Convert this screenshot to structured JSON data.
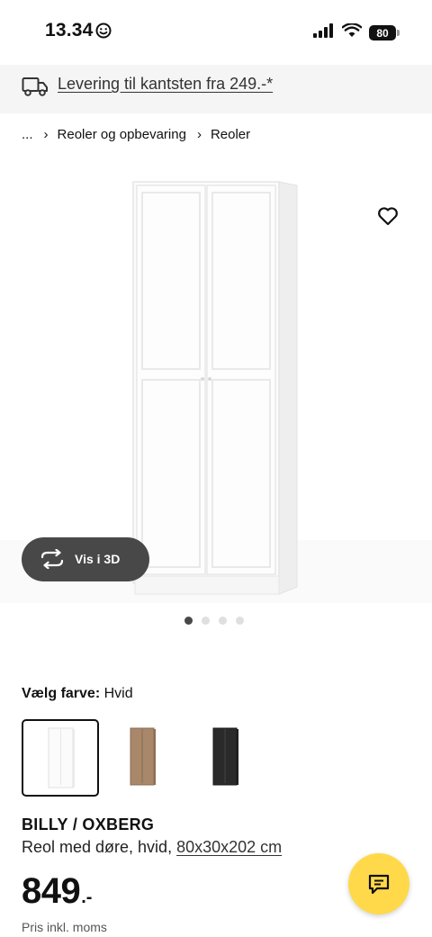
{
  "status_bar": {
    "time": "13.34",
    "emoji_icon": "smiley-face-icon",
    "battery": "80"
  },
  "delivery_banner": {
    "icon": "truck-icon",
    "text": "Levering til kantsten fra 249.-*"
  },
  "breadcrumb": {
    "items": [
      "...",
      "Reoler og opbevaring",
      "Reoler"
    ]
  },
  "product_image": {
    "favorite_icon": "heart-icon",
    "view_3d_label": "Vis i 3D",
    "carousel_count": 4,
    "carousel_active_index": 0
  },
  "color_picker": {
    "label": "Vælg farve:",
    "selected": "Hvid",
    "swatches": [
      "white",
      "oak-effect",
      "black"
    ]
  },
  "product": {
    "name": "BILLY / OXBERG",
    "description": "Reol med døre, hvid,",
    "size": "80x30x202 cm",
    "price": "849",
    "price_suffix": ".-",
    "price_note": "Pris inkl. moms"
  },
  "chat": {
    "icon": "chat-bubble-icon"
  },
  "colors": {
    "banner_bg": "#f5f5f5",
    "chat_button": "#ffd94a",
    "dark_pill": "#484848"
  }
}
